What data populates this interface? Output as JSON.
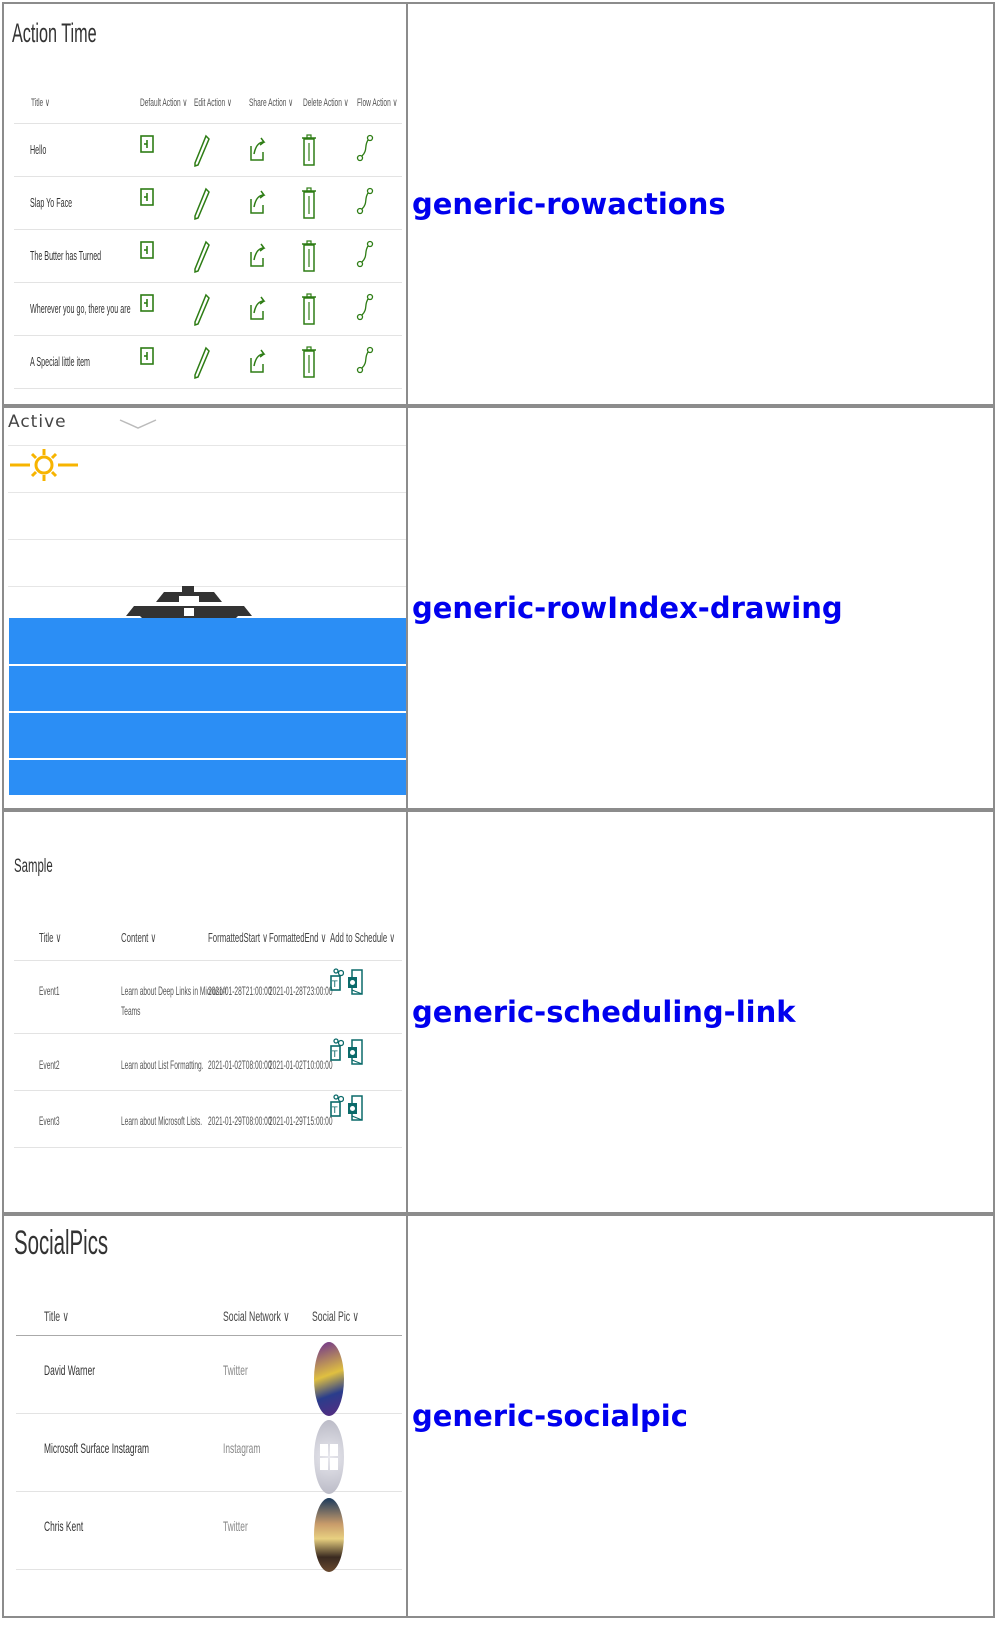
{
  "rows": [
    {
      "label": "generic-rowactions",
      "panel": {
        "title": "Action Time",
        "columns": [
          "Title",
          "Default Action",
          "Edit Action",
          "Share Action",
          "Delete Action",
          "Flow Action"
        ],
        "items": [
          "Hello",
          "Slap Yo Face",
          "The Butter has Turned",
          "Wherever you go, there you are",
          "A Special little item"
        ]
      }
    },
    {
      "label": "generic-rowIndex-drawing",
      "panel": {
        "column": "Active",
        "icons": [
          "sun-icon",
          "ship-icon"
        ],
        "fill_color": "#2b8ef5"
      }
    },
    {
      "label": "generic-scheduling-link",
      "panel": {
        "title": "Sample",
        "columns": [
          "Title",
          "Content",
          "FormattedStart",
          "FormattedEnd",
          "Add to Schedule"
        ],
        "events": [
          {
            "title": "Event1",
            "content_1": "Learn about Deep Links in Microsoft",
            "content_2": "Teams",
            "start": "2021-01-28T21:00:00",
            "end": "2021-01-28T23:00:00"
          },
          {
            "title": "Event2",
            "content_1": "Learn about List Formatting.",
            "content_2": "",
            "start": "2021-01-02T08:00:00",
            "end": "2021-01-02T10:00:00"
          },
          {
            "title": "Event3",
            "content_1": "Learn about Microsoft Lists.",
            "content_2": "",
            "start": "2021-01-29T08:00:00",
            "end": "2021-01-29T15:00:00"
          }
        ]
      }
    },
    {
      "label": "generic-socialpic",
      "panel": {
        "title": "SocialPics",
        "columns": [
          "Title",
          "Social Network",
          "Social Pic"
        ],
        "people": [
          {
            "name": "David Warner",
            "network": "Twitter"
          },
          {
            "name": "Microsoft Surface Instagram",
            "network": "Instagram"
          },
          {
            "name": "Chris Kent",
            "network": "Twitter"
          }
        ]
      }
    }
  ],
  "colors": {
    "action_green": "#2e7d15",
    "teams_teal": "#0b6a6a",
    "link_blue": "#0000ee"
  }
}
